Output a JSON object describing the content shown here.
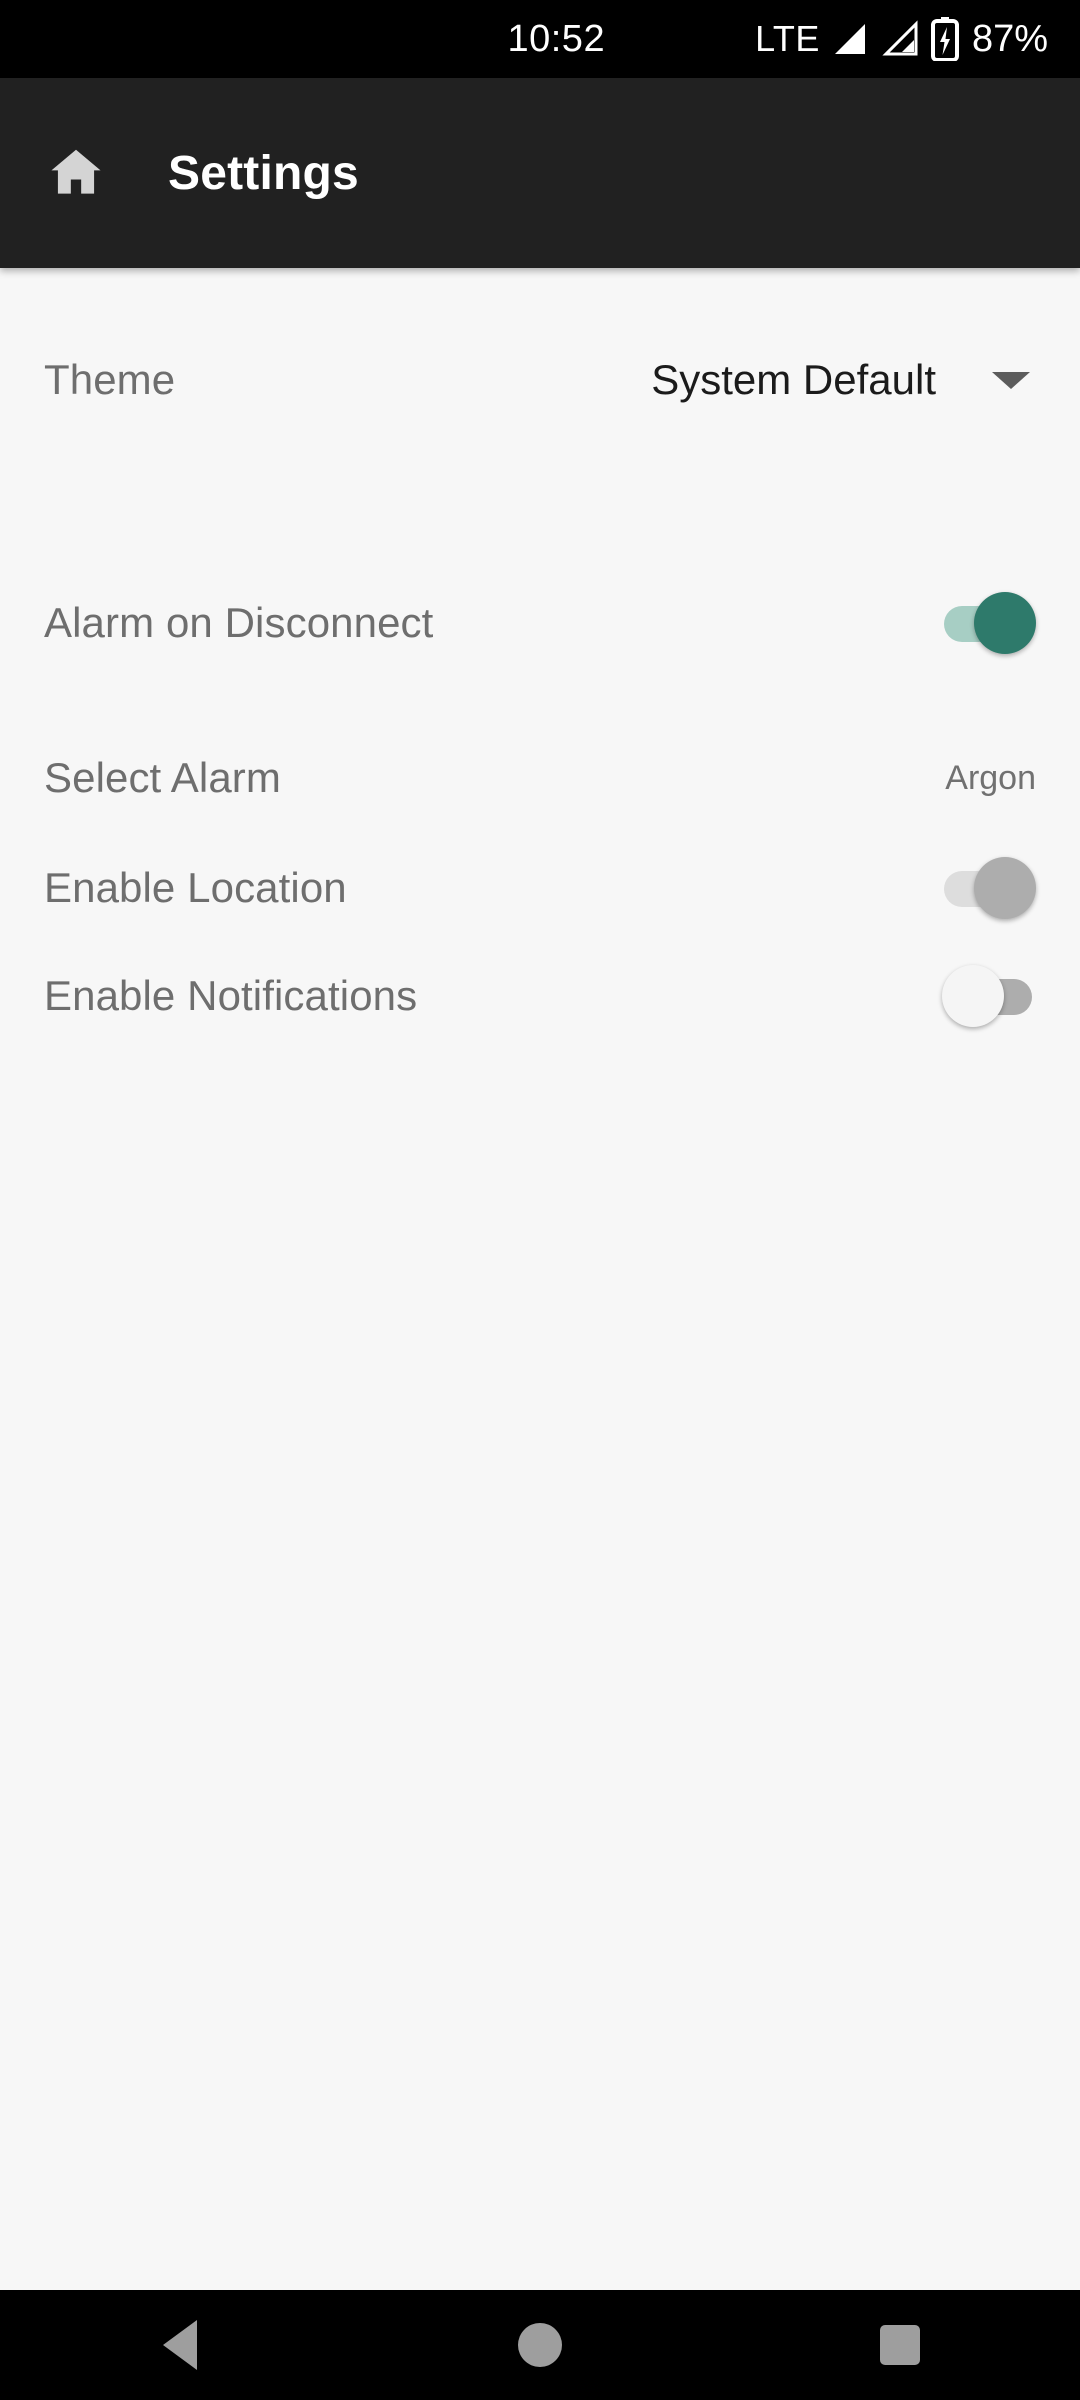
{
  "status_bar": {
    "clock": "10:52",
    "network_type": "LTE",
    "signal_icon_1": "signal-bars-icon",
    "signal_icon_2": "signal-bars-icon",
    "battery_icon": "battery-charging-icon",
    "battery_percent": "87%"
  },
  "app_bar": {
    "home_icon": "home-icon",
    "title": "Settings"
  },
  "settings": {
    "rows": [
      {
        "label": "Theme",
        "control": "spinner",
        "value": "System Default",
        "caret_icon": "chevron-down-icon"
      },
      {
        "label": "Alarm on Disconnect",
        "control": "switch",
        "state": "on",
        "enabled": true
      },
      {
        "label": "Select Alarm",
        "control": "value",
        "value": "Argon"
      },
      {
        "label": "Enable Location",
        "control": "switch",
        "state": "on",
        "enabled": false
      },
      {
        "label": "Enable Notifications",
        "control": "switch",
        "state": "off",
        "enabled": false
      }
    ]
  },
  "nav_bar": {
    "back_icon": "back-triangle-icon",
    "home_icon": "home-circle-icon",
    "recents_icon": "recents-square-icon"
  },
  "colors": {
    "accent_teal": "#2e7a6b",
    "track_teal": "#a7cec4",
    "app_bar": "#212121",
    "background": "#f7f7f7",
    "label_gray": "#6e6e6e",
    "nav_gray": "#9e9e9e"
  }
}
